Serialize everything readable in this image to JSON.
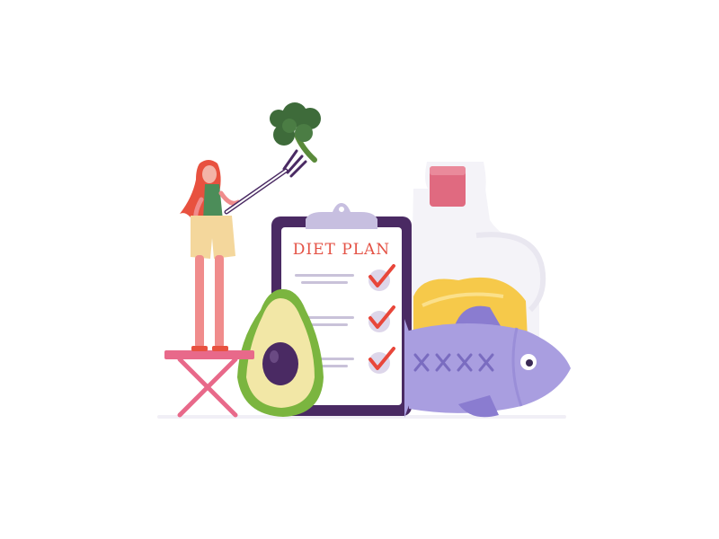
{
  "clipboard": {
    "title": "DIET PLAN",
    "items": [
      {
        "checked": true
      },
      {
        "checked": true
      },
      {
        "checked": true
      }
    ]
  },
  "colors": {
    "clipboard_board": "#4a2a63",
    "paper": "#ffffff",
    "title_text": "#e45245",
    "checkmark": "#e8463a",
    "check_circle": "#ddd6ea",
    "paper_lines": "#c9c2d9",
    "avocado_skin": "#7bb53f",
    "avocado_flesh": "#f2e7a6",
    "avocado_pit": "#4a2a63",
    "fish_body": "#a99ee0",
    "fish_fin": "#8a7cd0",
    "bottle_cap": "#e06a80",
    "bottle_glass": "#f4f3f8",
    "oil": "#f6c94a",
    "broccoli": "#3e6b3a",
    "stool": "#e8698a",
    "woman_hair": "#e8513f",
    "woman_legs": "#f08c8c",
    "woman_shorts": "#f4d79c",
    "woman_top": "#4c8d59"
  },
  "icons": [
    "woman-figure",
    "broccoli-icon",
    "fork-icon",
    "clipboard-icon",
    "checkmark-icon",
    "avocado-icon",
    "fish-icon",
    "oil-bottle-icon",
    "stool-icon"
  ]
}
